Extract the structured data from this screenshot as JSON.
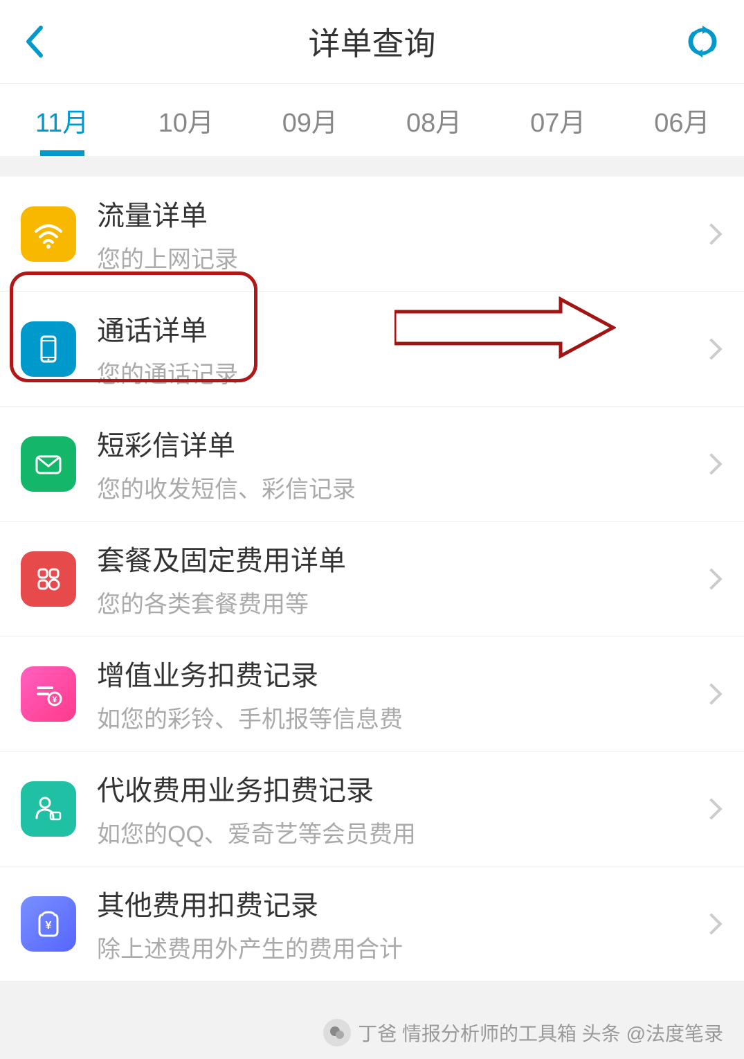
{
  "header": {
    "title": "详单查询"
  },
  "tabs": [
    "11月",
    "10月",
    "09月",
    "08月",
    "07月",
    "06月"
  ],
  "active_tab": 0,
  "items": [
    {
      "icon": "wifi-icon",
      "title": "流量详单",
      "subtitle": "您的上网记录"
    },
    {
      "icon": "phone-icon",
      "title": "通话详单",
      "subtitle": "您的通话记录"
    },
    {
      "icon": "mail-icon",
      "title": "短彩信详单",
      "subtitle": "您的收发短信、彩信记录"
    },
    {
      "icon": "package-icon",
      "title": "套餐及固定费用详单",
      "subtitle": "您的各类套餐费用等"
    },
    {
      "icon": "vas-icon",
      "title": "增值业务扣费记录",
      "subtitle": "如您的彩铃、手机报等信息费"
    },
    {
      "icon": "collect-icon",
      "title": "代收费用业务扣费记录",
      "subtitle": "如您的QQ、爱奇艺等会员费用"
    },
    {
      "icon": "other-icon",
      "title": "其他费用扣费记录",
      "subtitle": "除上述费用外产生的费用合计"
    }
  ],
  "watermark": "丁爸 情报分析师的工具箱  头条 @法度笔录"
}
